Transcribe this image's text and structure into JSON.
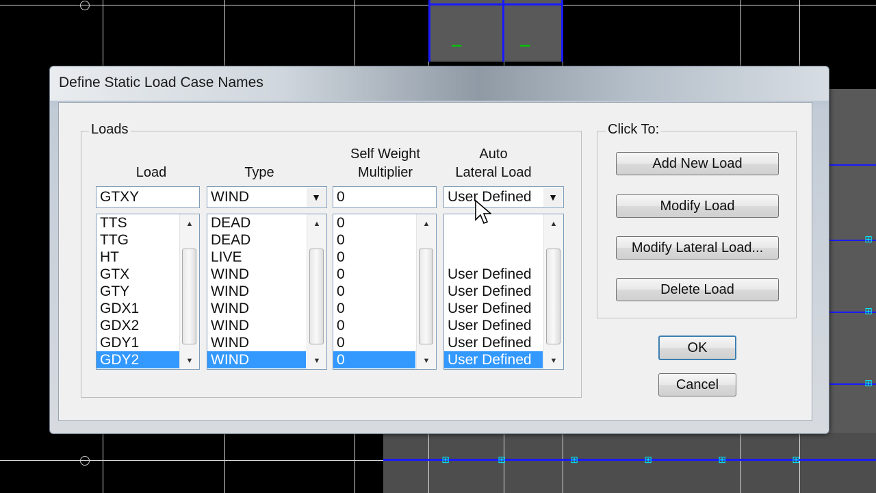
{
  "dialog": {
    "title": "Define Static Load Case Names",
    "loads_group_label": "Loads",
    "click_group_label": "Click To:"
  },
  "columns": {
    "load": "Load",
    "type": "Type",
    "self_weight_line1": "Self Weight",
    "self_weight_line2": "Multiplier",
    "auto_lateral_line1": "Auto",
    "auto_lateral_line2": "Lateral Load"
  },
  "inputs": {
    "load_name": "GTXY",
    "type": "WIND",
    "self_weight": "0",
    "auto_lateral": "User Defined"
  },
  "lists": {
    "loads": [
      "TTS",
      "TTG",
      "HT",
      "GTX",
      "GTY",
      "GDX1",
      "GDX2",
      "GDY1",
      "GDY2"
    ],
    "types": [
      "DEAD",
      "DEAD",
      "LIVE",
      "WIND",
      "WIND",
      "WIND",
      "WIND",
      "WIND",
      "WIND"
    ],
    "multipliers": [
      "0",
      "0",
      "0",
      "0",
      "0",
      "0",
      "0",
      "0",
      "0"
    ],
    "lateral": [
      "",
      "",
      "",
      "User Defined",
      "User Defined",
      "User Defined",
      "User Defined",
      "User Defined",
      "User Defined"
    ],
    "selected_index": 8
  },
  "buttons": {
    "add_new_load": "Add New Load",
    "modify_load": "Modify Load",
    "modify_lateral_load": "Modify Lateral Load...",
    "delete_load": "Delete Load",
    "ok": "OK",
    "cancel": "Cancel"
  },
  "colors": {
    "selection": "#3399ff",
    "cad_background": "#000000",
    "cad_frame": "#1a1aff",
    "cad_node": "#00e5ff"
  }
}
